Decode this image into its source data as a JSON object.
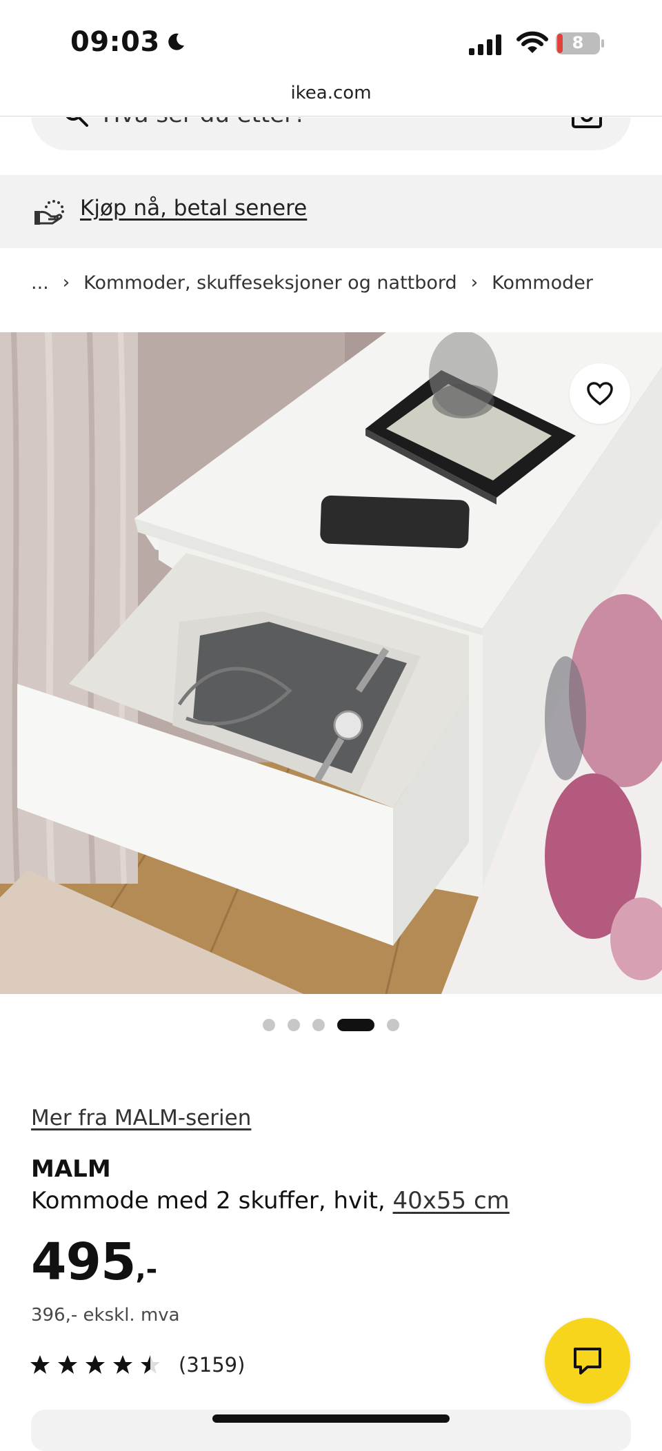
{
  "status_bar": {
    "time": "09:03",
    "battery_level": "8",
    "icons": [
      "moon-icon",
      "signal-icon",
      "wifi-icon",
      "battery-icon"
    ]
  },
  "browser": {
    "url": "ikea.com"
  },
  "search": {
    "placeholder": "Hva ser du etter?",
    "icons": [
      "search-icon",
      "camera-icon"
    ]
  },
  "banner": {
    "label": "Kjøp nå, betal senere",
    "icon": "payment-icon"
  },
  "breadcrumb": {
    "items": [
      "...",
      "Kommoder, skuffeseksjoner og nattbord",
      "Kommoder"
    ]
  },
  "gallery": {
    "dots_count": 5,
    "active_index": 3,
    "wishlist_icon": "heart-icon"
  },
  "product": {
    "series_link": "Mer fra MALM-serien",
    "name": "MALM",
    "description": "Kommode med 2 skuffer, hvit, ",
    "size": "40x55 cm",
    "price": "495",
    "price_suffix": ",-",
    "price_ex_vat": "396,- ekskl. mva",
    "rating": 4.5,
    "rating_max": 5,
    "review_count": "(3159)"
  },
  "chat": {
    "icon": "chat-icon"
  },
  "colors": {
    "chat_button": "#f7d51d",
    "banner_bg": "#f2f2f2",
    "battery_low": "#e0413a"
  }
}
